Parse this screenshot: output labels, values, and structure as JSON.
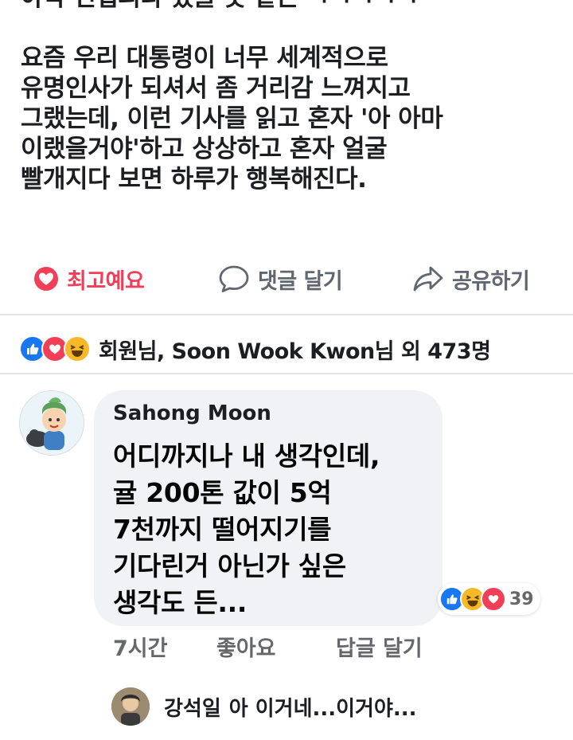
{
  "post": {
    "lines_top": [
      "아작 인접피라 쳤을 듯 같은 ㅋㅋㅋㅋㅋ"
    ],
    "lines_main": [
      "요즘 우리 대통령이 너무 세계적으로",
      "유명인사가 되셔서 좀 거리감 느껴지고",
      "그랬는데, 이런 기사를 읽고 혼자 '아 아마",
      "이랬을거야'하고 상상하고 혼자 얼굴",
      "빨개지다 보면 하루가 행복해진다."
    ]
  },
  "actions": {
    "love_label": "최고예요",
    "comment_label": "댓글 달기",
    "share_label": "공유하기"
  },
  "reactions": {
    "summary_text": "회원님, Soon Wook Kwon님 외 473명",
    "icons": [
      "like-icon",
      "love-icon",
      "haha-icon"
    ]
  },
  "comment": {
    "author": "Sahong Moon",
    "lines": [
      "어디까지나 내 생각인데,",
      "귤 200톤 값이 5억",
      "7천까지 떨어지기를",
      "기다린거 아닌가 싶은",
      "생각도 든..."
    ],
    "reaction_count": "39",
    "time": "7시간",
    "like_label": "좋아요",
    "reply_label": "답글 달기"
  },
  "reply": {
    "author": "강석일",
    "text": "아 이거네...이거야..."
  },
  "colors": {
    "love": "#f33e58",
    "like": "#1877f2",
    "haha": "#f7b928",
    "muted": "#65676b"
  }
}
